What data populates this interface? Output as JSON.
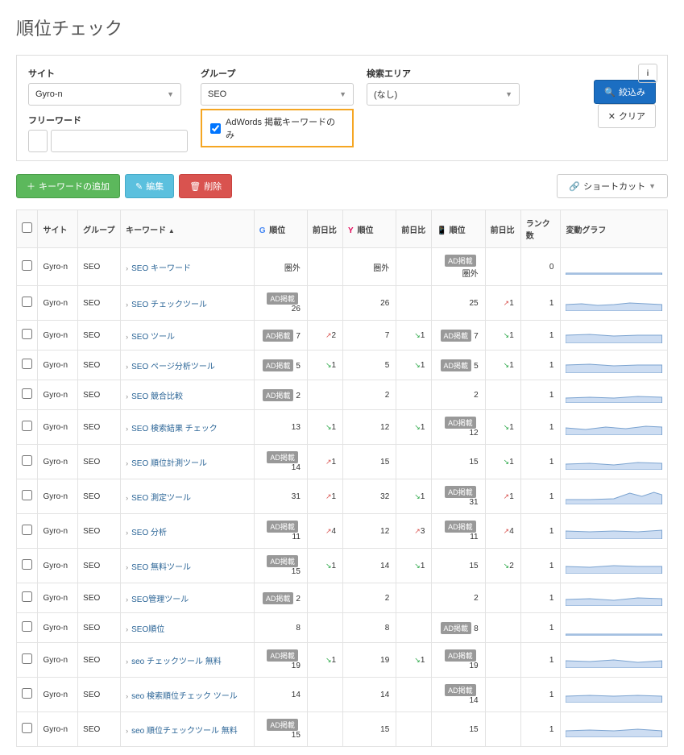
{
  "page_title": "順位チェック",
  "filters": {
    "site_label": "サイト",
    "site_value": "Gyro-n",
    "group_label": "グループ",
    "group_value": "SEO",
    "area_label": "検索エリア",
    "area_value": "(なし)",
    "freeword_label": "フリーワード",
    "adwords_label": "AdWords 掲載キーワードのみ",
    "adwords_checked": true
  },
  "buttons": {
    "filter": "絞込み",
    "clear": "クリア",
    "add_kw": "キーワードの追加",
    "edit": "編集",
    "delete": "削除",
    "shortcut": "ショートカット"
  },
  "columns": {
    "site": "サイト",
    "group": "グループ",
    "keyword": "キーワード",
    "rank": "順位",
    "diff": "前日比",
    "rankcount": "ランク数",
    "graph": "変動グラフ"
  },
  "badge_ad": "AD掲載",
  "out_of_range": "圏外",
  "rows": [
    {
      "site": "Gyro-n",
      "group": "SEO",
      "kw": "SEO キーワード",
      "g_badge": false,
      "g_rank": "圏外",
      "g_diff": "",
      "y_rank": "圏外",
      "y_diff": "",
      "m_badge": true,
      "m_rank": "圏外",
      "m_diff": "",
      "rankcount": "0",
      "spark": "flat"
    },
    {
      "site": "Gyro-n",
      "group": "SEO",
      "kw": "SEO チェックツール",
      "g_badge": true,
      "g_rank": "26",
      "g_diff": "",
      "y_rank": "26",
      "y_diff": "",
      "m_badge": false,
      "m_rank": "25",
      "m_diff": "up1",
      "rankcount": "1",
      "spark": "a"
    },
    {
      "site": "Gyro-n",
      "group": "SEO",
      "kw": "SEO ツール",
      "g_badge": true,
      "g_rank": "7",
      "g_diff": "up2",
      "y_rank": "7",
      "y_diff": "dn1",
      "m_badge": true,
      "m_rank": "7",
      "m_diff": "dn1",
      "rankcount": "1",
      "spark": "b"
    },
    {
      "site": "Gyro-n",
      "group": "SEO",
      "kw": "SEO ページ分析ツール",
      "g_badge": true,
      "g_rank": "5",
      "g_diff": "dn1",
      "y_rank": "5",
      "y_diff": "dn1",
      "m_badge": true,
      "m_rank": "5",
      "m_diff": "dn1",
      "rankcount": "1",
      "spark": "b"
    },
    {
      "site": "Gyro-n",
      "group": "SEO",
      "kw": "SEO 競合比較",
      "g_badge": true,
      "g_rank": "2",
      "g_diff": "",
      "y_rank": "2",
      "y_diff": "",
      "m_badge": false,
      "m_rank": "2",
      "m_diff": "",
      "rankcount": "1",
      "spark": "c"
    },
    {
      "site": "Gyro-n",
      "group": "SEO",
      "kw": "SEO 検索結果 チェック",
      "g_badge": false,
      "g_rank": "13",
      "g_diff": "dn1",
      "y_rank": "12",
      "y_diff": "dn1",
      "m_badge": true,
      "m_rank": "12",
      "m_diff": "dn1",
      "rankcount": "1",
      "spark": "d"
    },
    {
      "site": "Gyro-n",
      "group": "SEO",
      "kw": "SEO 順位計測ツール",
      "g_badge": true,
      "g_rank": "14",
      "g_diff": "up1",
      "y_rank": "15",
      "y_diff": "",
      "m_badge": false,
      "m_rank": "15",
      "m_diff": "dn1",
      "rankcount": "1",
      "spark": "e"
    },
    {
      "site": "Gyro-n",
      "group": "SEO",
      "kw": "SEO 測定ツール",
      "g_badge": false,
      "g_rank": "31",
      "g_diff": "up1",
      "y_rank": "32",
      "y_diff": "dn1",
      "m_badge": true,
      "m_rank": "31",
      "m_diff": "up1",
      "rankcount": "1",
      "spark": "f"
    },
    {
      "site": "Gyro-n",
      "group": "SEO",
      "kw": "SEO 分析",
      "g_badge": true,
      "g_rank": "11",
      "g_diff": "up4",
      "y_rank": "12",
      "y_diff": "up3",
      "m_badge": true,
      "m_rank": "11",
      "m_diff": "up4",
      "rankcount": "1",
      "spark": "g"
    },
    {
      "site": "Gyro-n",
      "group": "SEO",
      "kw": "SEO 無料ツール",
      "g_badge": true,
      "g_rank": "15",
      "g_diff": "dn1",
      "y_rank": "14",
      "y_diff": "dn1",
      "m_badge": false,
      "m_rank": "15",
      "m_diff": "dn2",
      "rankcount": "1",
      "spark": "h"
    },
    {
      "site": "Gyro-n",
      "group": "SEO",
      "kw": "SEO管理ツール",
      "g_badge": true,
      "g_rank": "2",
      "g_diff": "",
      "y_rank": "2",
      "y_diff": "",
      "m_badge": false,
      "m_rank": "2",
      "m_diff": "",
      "rankcount": "1",
      "spark": "i"
    },
    {
      "site": "Gyro-n",
      "group": "SEO",
      "kw": "SEO順位",
      "g_badge": false,
      "g_rank": "8",
      "g_diff": "",
      "y_rank": "8",
      "y_diff": "",
      "m_badge": true,
      "m_rank": "8",
      "m_diff": "",
      "rankcount": "1",
      "spark": "flat"
    },
    {
      "site": "Gyro-n",
      "group": "SEO",
      "kw": "seo チェックツール 無料",
      "g_badge": true,
      "g_rank": "19",
      "g_diff": "dn1",
      "y_rank": "19",
      "y_diff": "dn1",
      "m_badge": true,
      "m_rank": "19",
      "m_diff": "",
      "rankcount": "1",
      "spark": "j"
    },
    {
      "site": "Gyro-n",
      "group": "SEO",
      "kw": "seo 検索順位チェック ツール",
      "g_badge": false,
      "g_rank": "14",
      "g_diff": "",
      "y_rank": "14",
      "y_diff": "",
      "m_badge": true,
      "m_rank": "14",
      "m_diff": "",
      "rankcount": "1",
      "spark": "k"
    },
    {
      "site": "Gyro-n",
      "group": "SEO",
      "kw": "seo 順位チェックツール 無料",
      "g_badge": true,
      "g_rank": "15",
      "g_diff": "",
      "y_rank": "15",
      "y_diff": "",
      "m_badge": false,
      "m_rank": "15",
      "m_diff": "",
      "rankcount": "1",
      "spark": "l"
    }
  ]
}
